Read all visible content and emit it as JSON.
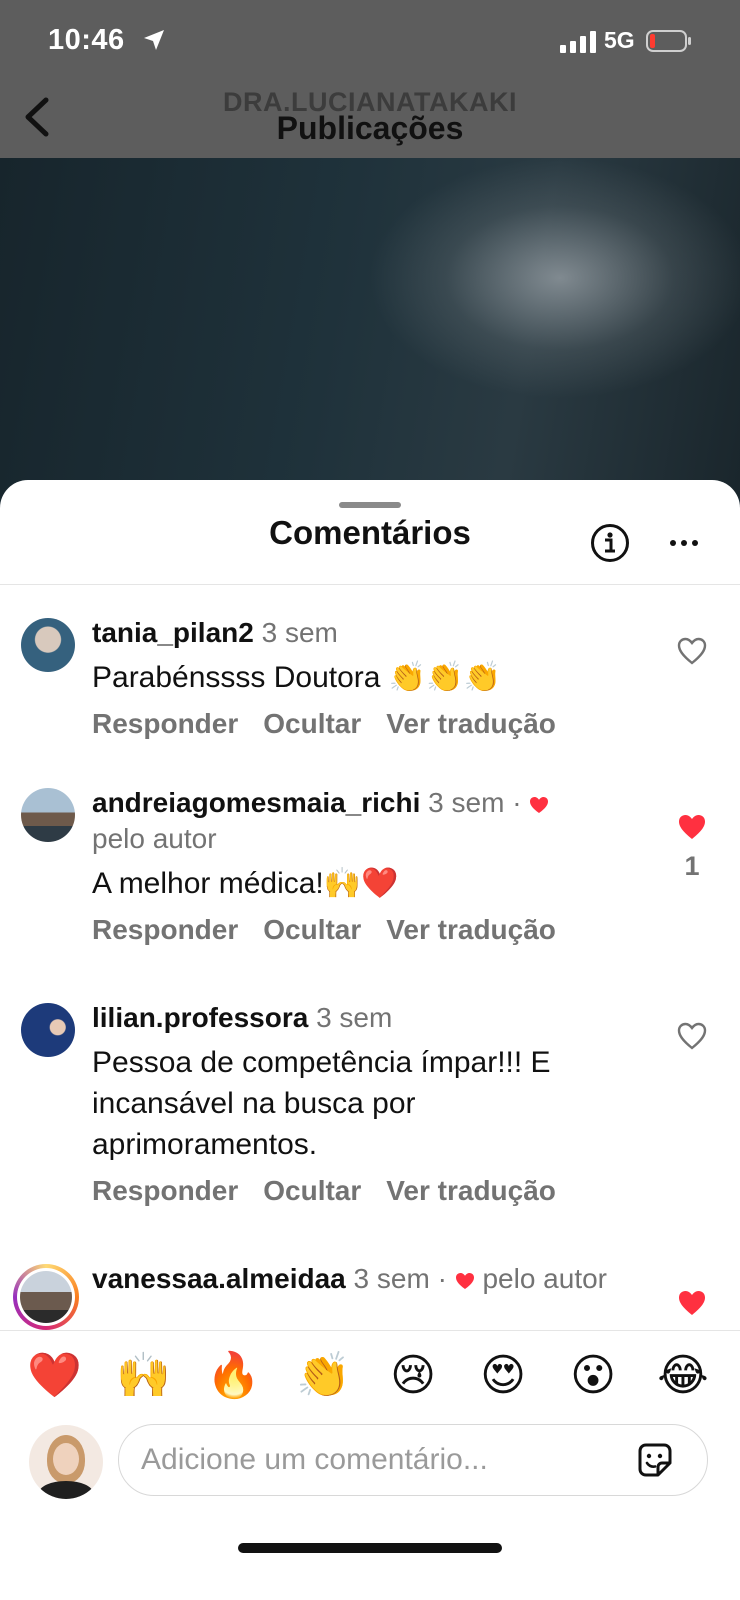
{
  "status_bar": {
    "time": "10:46",
    "network": "5G"
  },
  "header": {
    "account": "DRA.LUCIANATAKAKI",
    "title": "Publicações"
  },
  "sheet": {
    "title": "Comentários"
  },
  "comments": [
    {
      "user": "tania_pilan2",
      "time": "3 sem",
      "author_liked": false,
      "by_author_text": "",
      "text": "Parabénssss Doutora 👏👏👏",
      "actions": [
        "Responder",
        "Ocultar",
        "Ver tradução"
      ],
      "liked": false,
      "like_count": ""
    },
    {
      "user": "andreiagomesmaia_richi",
      "time": "3 sem",
      "author_liked": true,
      "by_author_text": "pelo autor",
      "text": "A melhor médica!🙌❤️",
      "actions": [
        "Responder",
        "Ocultar",
        "Ver tradução"
      ],
      "liked": true,
      "like_count": "1"
    },
    {
      "user": "lilian.professora",
      "time": "3 sem",
      "author_liked": false,
      "by_author_text": "",
      "text": "Pessoa de competência ímpar!!! E incansável na busca por aprimoramentos.",
      "actions": [
        "Responder",
        "Ocultar",
        "Ver tradução"
      ],
      "liked": false,
      "like_count": ""
    },
    {
      "user": "vanessaa.almeidaa",
      "time": "3 sem",
      "author_liked": true,
      "by_author_text": "pelo autor",
      "text": "",
      "actions": [],
      "liked": true,
      "like_count": ""
    }
  ],
  "emoji_reactions": [
    "❤️",
    "🙌",
    "🔥",
    "👏",
    "😢",
    "😍",
    "😮",
    "😂"
  ],
  "composer": {
    "placeholder": "Adicione um comentário..."
  },
  "colors": {
    "heart_red": "#ff3040",
    "secondary_text": "#737373"
  },
  "icons": [
    "location-arrow-icon",
    "signal-icon",
    "battery-icon",
    "back-chevron-icon",
    "info-icon",
    "more-options-icon",
    "heart-outline-icon",
    "heart-filled-icon",
    "sticker-icon"
  ]
}
